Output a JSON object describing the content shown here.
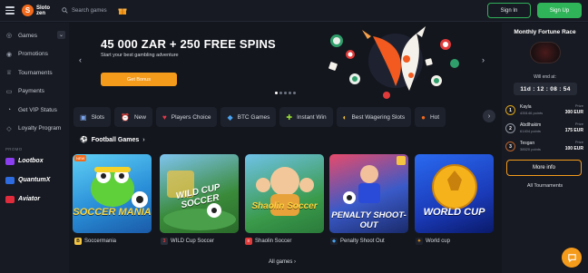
{
  "header": {
    "logo_mark": "S",
    "logo_text_1": "Sloto",
    "logo_text_2": "zen",
    "search_placeholder": "Search games",
    "signin_label": "Sign In",
    "signup_label": "Sign Up",
    "colors": {
      "accent": "#30b45a",
      "brand": "#f26b1d"
    }
  },
  "sidebar": {
    "items": [
      {
        "label": "Games",
        "icon": "gamepad-icon"
      },
      {
        "label": "Promotions",
        "icon": "promo-icon"
      },
      {
        "label": "Tournaments",
        "icon": "trophy-icon"
      },
      {
        "label": "Payments",
        "icon": "wallet-icon"
      },
      {
        "label": "Get VIP Status",
        "icon": "vip-icon"
      },
      {
        "label": "Loyalty Program",
        "icon": "diamond-icon"
      }
    ],
    "promo_label": "PROMO",
    "promos": [
      {
        "label": "Lootbox",
        "color": "#8b3df0"
      },
      {
        "label": "QuantumX",
        "color": "#2f6be0"
      },
      {
        "label": "Aviator",
        "color": "#e02b3c"
      }
    ]
  },
  "banner": {
    "title": "45 000 ZAR + 250 FREE SPINS",
    "subtitle": "Start your best gambling adventure",
    "button": "Get Bonus",
    "prev": "‹",
    "next": "›"
  },
  "categories": [
    {
      "label": "Slots",
      "icon": "slot-icon",
      "glyph": "▣"
    },
    {
      "label": "New",
      "icon": "new-icon",
      "glyph": "⏰"
    },
    {
      "label": "Players Choice",
      "icon": "heart-icon",
      "glyph": "♥"
    },
    {
      "label": "BTC Games",
      "icon": "btc-icon",
      "glyph": "◆"
    },
    {
      "label": "Instant Win",
      "icon": "puzzle-icon",
      "glyph": "✚"
    },
    {
      "label": "Best Wagering Slots",
      "icon": "wager-icon",
      "glyph": "◐"
    },
    {
      "label": "Hot",
      "icon": "fire-icon",
      "glyph": "●"
    }
  ],
  "section": {
    "title": "Football Games",
    "all_games": "All games"
  },
  "games": [
    {
      "name": "Soccermania",
      "title": "SOCCER MANIA",
      "provider": "B",
      "badge": "NEW"
    },
    {
      "name": "WILD Cup Soccer",
      "title": "WILD CUP SOCCER",
      "provider": "3"
    },
    {
      "name": "Shaolin Soccer",
      "title": "Shaolin Soccer",
      "provider": "≡"
    },
    {
      "name": "Penalty Shoot Out",
      "title": "PENALTY SHOOT-OUT",
      "provider": "◆"
    },
    {
      "name": "World cup",
      "title": "WORLD CUP",
      "provider": "✦"
    }
  ],
  "race": {
    "title": "Monthly Fortune Race",
    "will_end": "Will end at:",
    "timer": "11d : 12 : 08 : 54",
    "prize_label": "Prize",
    "ranks": [
      {
        "num": "1",
        "name": "Kayla",
        "points": "435146 points",
        "prize": "300 EUR",
        "color": "#d9a21b"
      },
      {
        "num": "2",
        "name": "Abdlhakim",
        "points": "61404 points",
        "prize": "175 EUR",
        "color": "#8e939e"
      },
      {
        "num": "3",
        "name": "Tesgan",
        "points": "38520 points",
        "prize": "100 EUR",
        "color": "#b8622b"
      }
    ],
    "more_info": "More info",
    "all_tournaments": "All Tournaments"
  }
}
